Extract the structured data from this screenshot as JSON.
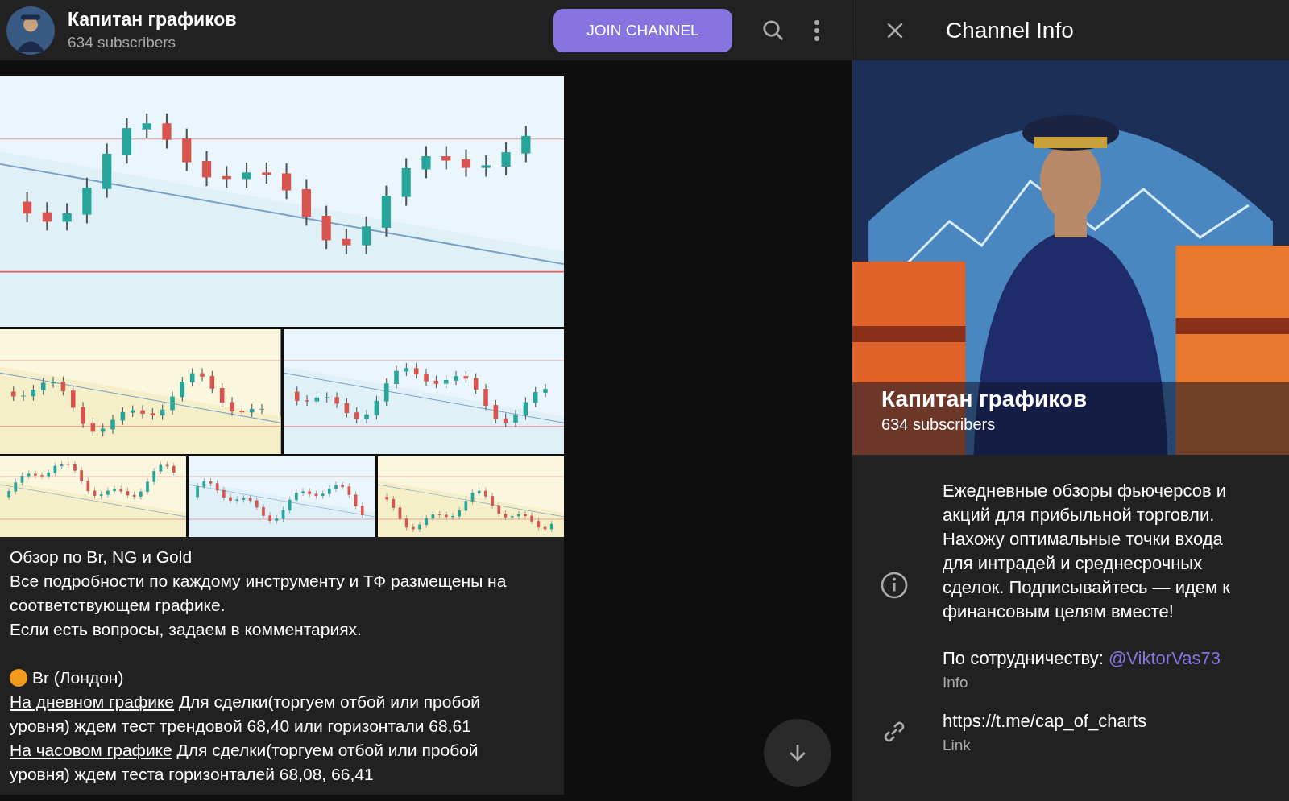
{
  "header": {
    "title": "Капитан графиков",
    "subtitle": "634 subscribers",
    "join_button": "JOIN CHANNEL"
  },
  "post": {
    "title": "Обзор по Br, NG и Gold",
    "lines": [
      "Все подробности по каждому инструменту и ТФ размещены на соответствующем графике.",
      "Если есть вопросы, задаем в комментариях."
    ],
    "section_title": "Br (Лондон)",
    "entries": [
      {
        "link": "На дневном графике",
        "text": "Для сделки(торгуем отбой или пробой уровня) ждем тест трендовой 68,40 или горизонтали 68,61"
      },
      {
        "link": "На часовом графике",
        "text": "Для сделки(торгуем отбой или пробой уровня) ждем теста горизонталей 68,08, 66,41"
      }
    ]
  },
  "info_panel": {
    "title": "Channel Info",
    "name": "Капитан графиков",
    "subscribers": "634 subscribers",
    "description": "Ежедневные обзоры фьючерсов и акций для прибыльной торговли. Нахожу оптимальные точки входа для интрадей и среднесрочных сделок. Подписывайтесь — идем к финансовым целям вместе!",
    "contact": {
      "label": "По сотрудничеству:",
      "handle": "@ViktorVas73",
      "caption": "Info"
    },
    "link": {
      "url": "https://t.me/cap_of_charts",
      "caption": "Link"
    }
  }
}
